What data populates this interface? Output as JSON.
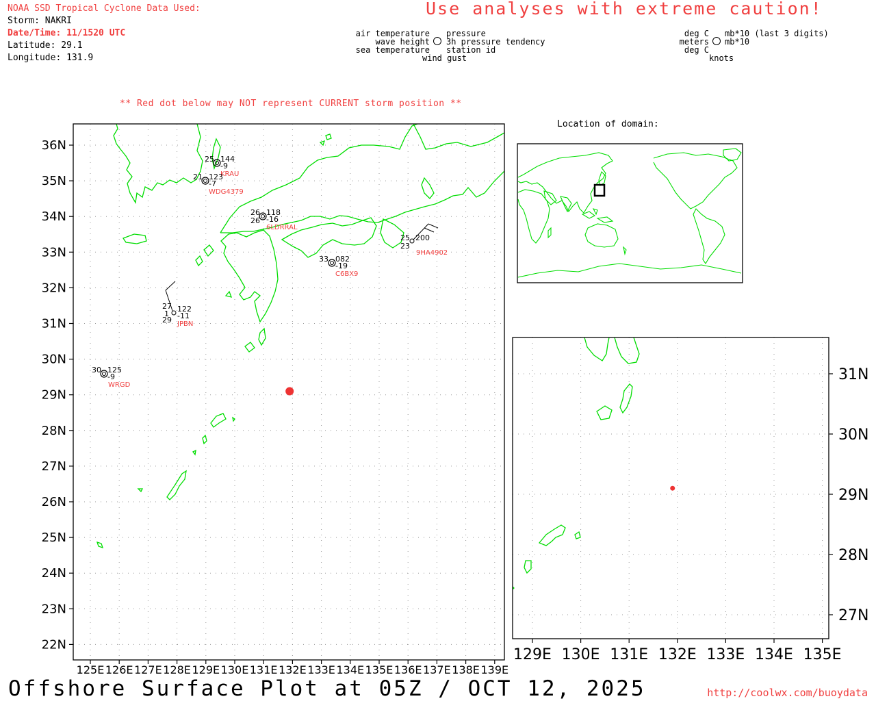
{
  "header": {
    "source": "NOAA SSD Tropical Cyclone Data Used:",
    "storm": "Storm: NAKRI",
    "datetime": "Date/Time: 11/1520 UTC",
    "latitude": "Latitude: 29.1",
    "longitude": "Longitude: 131.9",
    "caution": "Use analyses with extreme caution!"
  },
  "station_legend": {
    "air_temperature": "air temperature",
    "wave_height": "wave height",
    "sea_temperature": "sea temperature",
    "pressure": "pressure",
    "pressure_tendency": "3h pressure tendency",
    "station_id": "station id",
    "wind_gust": "wind gust"
  },
  "units_legend": {
    "deg_c_top": "deg C",
    "meters": "meters",
    "deg_c_bottom": "deg C",
    "mb_last3": "mb*10 (last 3 digits)",
    "mb10": "mb*10",
    "knots": "knots"
  },
  "note": "** Red dot below may NOT represent CURRENT storm position **",
  "domain_label": "Location of domain:",
  "main_map": {
    "lon_labels": [
      "125E",
      "126E",
      "127E",
      "128E",
      "129E",
      "130E",
      "131E",
      "132E",
      "133E",
      "134E",
      "135E",
      "136E",
      "137E",
      "138E",
      "139E"
    ],
    "lat_labels": [
      "36N",
      "35N",
      "34N",
      "33N",
      "32N",
      "31N",
      "30N",
      "29N",
      "28N",
      "27N",
      "26N",
      "25N",
      "24N",
      "23N",
      "22N"
    ]
  },
  "inset_map": {
    "lon_labels": [
      "129E",
      "130E",
      "131E",
      "132E",
      "133E",
      "134E",
      "135E"
    ],
    "lat_labels": [
      "31N",
      "30N",
      "29N",
      "28N",
      "27N"
    ]
  },
  "stations": [
    {
      "id": "KRAU",
      "air": "25",
      "pressure": "144",
      "tendency": "-9"
    },
    {
      "id": "WDG4379",
      "air": "21",
      "pressure": "123",
      "tendency": "-7"
    },
    {
      "id": "6LDRRAL",
      "air": "26",
      "sea": "26",
      "pressure": "118",
      "tendency": "-16"
    },
    {
      "id": "C6BX9",
      "air": "33",
      "pressure": "082",
      "tendency": "-19"
    },
    {
      "id": "9HA4902",
      "air": "25",
      "sea": "23",
      "pressure": "200"
    },
    {
      "id": "JPBN",
      "air": "27",
      "wave": "1",
      "sea": "29",
      "pressure": "122",
      "tendency": "-11"
    },
    {
      "id": "WRGD",
      "air": "30",
      "pressure": "125",
      "tendency": "-9"
    }
  ],
  "storm_position": {
    "lat": 29.1,
    "lon": 131.9
  },
  "colors": {
    "coast": "#00dd00",
    "storm": "#ee3333",
    "label": "#f04040"
  },
  "footer": {
    "title": "Offshore Surface Plot at 05Z / OCT 12, 2025",
    "url": "http://coolwx.com/buoydata"
  }
}
